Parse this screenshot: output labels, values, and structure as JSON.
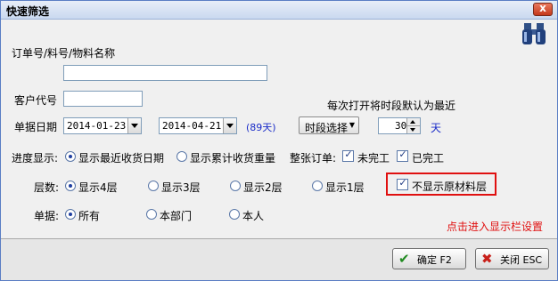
{
  "window": {
    "title": "快速筛选",
    "close_glyph": "x"
  },
  "icons": {
    "binoculars": "binoculars-icon",
    "confirm": "checkmark-icon",
    "close": "close-x-icon"
  },
  "colors": {
    "accent_blue": "#1a2cc8",
    "highlight_red": "#e01010"
  },
  "filters": {
    "order_label": "订单号/料号/物料名称",
    "order_value": "",
    "customer_label": "客户代号",
    "customer_value": "",
    "period_hint": "每次打开将时段默认为最近",
    "date_label": "单据日期",
    "date_from": "2014-01-23",
    "date_to": "2014-04-21",
    "day_span": "(89天)",
    "period_button": "时段选择",
    "recent_days": "30",
    "days_unit": "天"
  },
  "progress": {
    "label": "进度显示:",
    "options": [
      {
        "label": "显示最近收货日期",
        "selected": true
      },
      {
        "label": "显示累计收货重量",
        "selected": false
      }
    ]
  },
  "whole_order": {
    "label": "整张订单:",
    "options": [
      {
        "label": "未完工",
        "checked": true
      },
      {
        "label": "已完工",
        "checked": true
      }
    ]
  },
  "levels": {
    "label": "层数:",
    "options": [
      {
        "label": "显示4层",
        "selected": true
      },
      {
        "label": "显示3层",
        "selected": false
      },
      {
        "label": "显示2层",
        "selected": false
      },
      {
        "label": "显示1层",
        "selected": false
      }
    ],
    "hide_raw_material_label": "不显示原材料层",
    "hide_raw_material_checked": true
  },
  "document": {
    "label": "单据:",
    "options": [
      {
        "label": "所有",
        "selected": true
      },
      {
        "label": "本部门",
        "selected": false
      },
      {
        "label": "本人",
        "selected": false
      }
    ]
  },
  "column_settings_link": "点击进入显示栏设置",
  "buttons": {
    "confirm": "确定 F2",
    "close": "关闭 ESC"
  }
}
